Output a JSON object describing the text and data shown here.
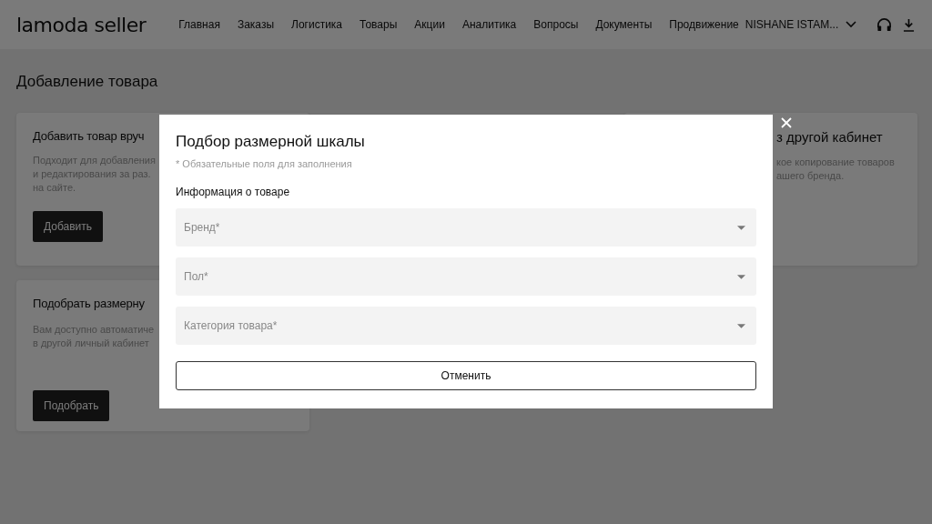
{
  "header": {
    "logo": "lamoda seller",
    "nav": [
      "Главная",
      "Заказы",
      "Логистика",
      "Товары",
      "Акции",
      "Аналитика",
      "Вопросы",
      "Документы",
      "Продвижение"
    ],
    "user": "NISHANE ISTAM..."
  },
  "page_title": "Добавление товара",
  "cards": [
    {
      "title": "Добавить товар вруч",
      "lines": [
        "Подходит для добавления",
        "и редактирования за раз.",
        "на сайте."
      ],
      "button": "Добавить"
    },
    {
      "title": "Подобрать размерну",
      "lines": [
        "Вам доступно автоматиче",
        "в другой личный кабинет"
      ],
      "button": "Подобрать"
    },
    {
      "title": "з другой кабинет",
      "lines": [
        "кое копирование товаров",
        "ашего бренда."
      ]
    }
  ],
  "modal": {
    "title": "Подбор размерной шкалы",
    "note": "* Обязательные поля для заполнения",
    "section": "Информация о товаре",
    "fields": [
      {
        "placeholder": "Бренд*"
      },
      {
        "placeholder": "Пол*"
      },
      {
        "placeholder": "Категория товара*"
      }
    ],
    "cancel": "Отменить"
  }
}
